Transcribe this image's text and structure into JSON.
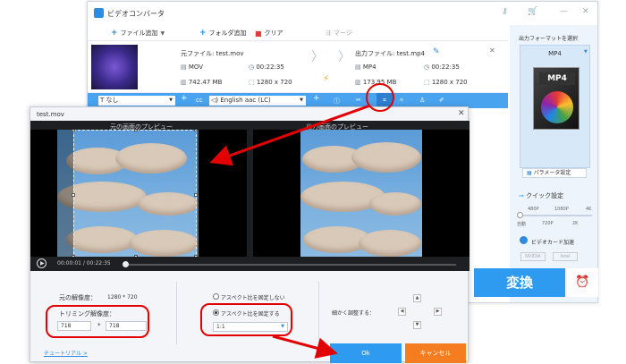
{
  "app": {
    "title": "ビデオコンバータ",
    "toolbar": {
      "add_file": "ファイル追加",
      "add_folder": "フォルダ追加",
      "clear": "クリア",
      "merge": "マージ"
    },
    "source": {
      "label": "元ファイル: test.mov",
      "format": "MOV",
      "duration": "00:22:35",
      "size": "742.47 MB",
      "resolution": "1280 x 720"
    },
    "output": {
      "label": "出力ファイル: test.mp4",
      "format": "MP4",
      "duration": "00:22:35",
      "size": "173.95 MB",
      "resolution": "1280 x 720"
    },
    "band": {
      "subtitle": "なし",
      "audio": "English aac (LC)"
    },
    "right_panel": {
      "format_title": "出力フォーマットを選択",
      "format": "MP4",
      "param_button": "パラメータ設定",
      "quick_title": "クイック設定",
      "scale_top": [
        "480P",
        "1080P",
        "4K"
      ],
      "scale_bottom": [
        "自動",
        "720P",
        "2K"
      ],
      "gpu_label": "ビデオカード加速",
      "gpu_brands": [
        "NVIDIA",
        "Intel"
      ],
      "convert": "変換"
    }
  },
  "dialog": {
    "title": "test.mov",
    "original_preview": "元の画面のプレビュー",
    "output_preview": "出力画面のプレビュー",
    "time": "00:00:01 / 00:22:35",
    "original_resolution_label": "元の解像度：",
    "original_resolution_value": "1280 * 720",
    "trim_resolution_label": "トリミング解像度：",
    "trim_width": "718",
    "trim_sep": "*",
    "trim_height": "718",
    "aspect_free": "アスペクト比を固定しない",
    "aspect_fixed": "アスペクト比を固定する",
    "aspect_value": "1:1",
    "fine_adjust": "細かく調整する：",
    "tutorial": "チュートリアル >",
    "ok": "Ok",
    "cancel": "キャンセル"
  },
  "colors": {
    "accent_blue": "#2f9bf0",
    "cancel_orange": "#f57c1f",
    "highlight_red": "#e30000"
  }
}
